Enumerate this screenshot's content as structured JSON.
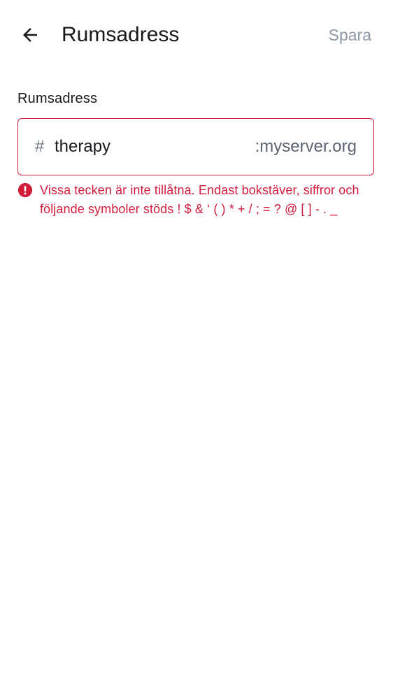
{
  "header": {
    "back_icon": "arrow-left-icon",
    "title": "Rumsadress",
    "save_label": "Spara"
  },
  "form": {
    "label": "Rumsadress",
    "prefix": "#",
    "value": "therapy",
    "suffix": ":myserver.org",
    "error_icon": "error-circle-icon",
    "error_message": "Vissa tecken är inte tillåtna. Endast bokstäver, siffror och följande symboler stöds ! $ & ‘ ( ) * + / ; = ? @ [ ] - . _"
  },
  "colors": {
    "error": "#d31c3c",
    "text": "#17191c",
    "muted": "#8d97a5"
  }
}
